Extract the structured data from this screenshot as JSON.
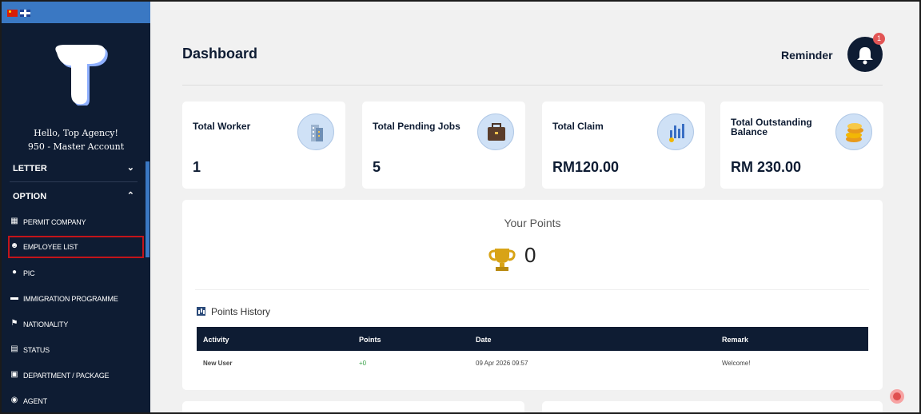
{
  "sidebar": {
    "greeting": "Hello, Top Agency!",
    "account": "950 - Master Account",
    "sections": [
      {
        "label": "LETTER",
        "chevron": "⌄"
      },
      {
        "label": "OPTION",
        "chevron": "⌃"
      }
    ],
    "items": [
      {
        "label": "PERMIT COMPANY",
        "icon": "building-icon"
      },
      {
        "label": "EMPLOYEE LIST",
        "icon": "users-icon"
      },
      {
        "label": "PIC",
        "icon": "user-icon"
      },
      {
        "label": "IMMIGRATION PROGRAMME",
        "icon": "folder-icon"
      },
      {
        "label": "NATIONALITY",
        "icon": "flag-icon"
      },
      {
        "label": "STATUS",
        "icon": "clipboard-icon"
      },
      {
        "label": "DEPARTMENT / PACKAGE",
        "icon": "package-icon"
      },
      {
        "label": "AGENT",
        "icon": "agent-icon"
      }
    ]
  },
  "header": {
    "title": "Dashboard",
    "reminder_label": "Reminder",
    "notification_count": "1"
  },
  "cards": [
    {
      "title": "Total Worker",
      "value": "1",
      "icon": "building-icon"
    },
    {
      "title": "Total Pending Jobs",
      "value": "5",
      "icon": "briefcase-icon"
    },
    {
      "title": "Total Claim",
      "value": "RM120.00",
      "icon": "chart-coin-icon"
    },
    {
      "title": "Total Outstanding Balance",
      "value": "RM 230.00",
      "icon": "coins-icon"
    }
  ],
  "points": {
    "title": "Your Points",
    "value": "0",
    "history_title": "Points History",
    "columns": [
      "Activity",
      "Points",
      "Date",
      "Remark"
    ],
    "rows": [
      {
        "activity": "New User",
        "points": "+0",
        "date": "09 Apr 2026 09:57",
        "remark": "Welcome!"
      }
    ]
  },
  "colors": {
    "sidebar_bg": "#0e1c33",
    "accent": "#3a78c3",
    "highlight": "#c3141a",
    "positive": "#3aa24a"
  }
}
